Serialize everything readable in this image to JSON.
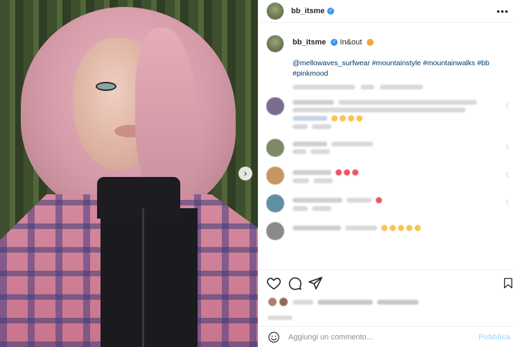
{
  "post": {
    "username": "bb_itsme",
    "caption_text": "In&out",
    "hashtags": "@mellowaves_surfwear #mountainstyle #mountainwalks #bb #pinkmood"
  },
  "icons": {
    "more": "more-options-icon",
    "like": "heart-icon",
    "comment": "comment-icon",
    "share": "paper-plane-icon",
    "save": "bookmark-icon",
    "emoji": "smiley-icon",
    "next": "chevron-right-icon"
  },
  "comment_box": {
    "placeholder": "Aggiungi un commento...",
    "post_label": "Pubblica"
  },
  "colors": {
    "verified": "#3897f0",
    "link": "#00376b",
    "post_button": "#b2dffc"
  }
}
